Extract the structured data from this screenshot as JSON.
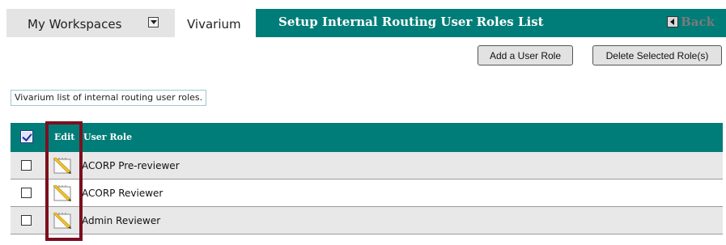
{
  "nav": {
    "workspaces_label": "My Workspaces",
    "workspaces_dropdown_icon": "chevron-down-icon",
    "vivarium_tab": "Vivarium",
    "page_title": "Setup Internal Routing User Roles List",
    "back_label": "Back",
    "back_icon": "arrow-left-icon"
  },
  "toolbar": {
    "add_label": "Add a User Role",
    "delete_label": "Delete Selected Role(s)"
  },
  "description": "Vivarium list of internal routing user roles.",
  "table": {
    "select_all_icon": "select-all-checkbox-icon",
    "columns": {
      "edit": "Edit",
      "role": "User Role"
    },
    "rows": [
      {
        "role": "ACORP Pre-reviewer",
        "checked": false,
        "edit_icon": "edit-pencil-icon"
      },
      {
        "role": "ACORP Reviewer",
        "checked": false,
        "edit_icon": "edit-pencil-icon"
      },
      {
        "role": "Admin Reviewer",
        "checked": false,
        "edit_icon": "edit-pencil-icon"
      }
    ]
  },
  "colors": {
    "accent": "#007d78",
    "highlight": "#7a1020",
    "row_alt": "#e8e8e8"
  }
}
